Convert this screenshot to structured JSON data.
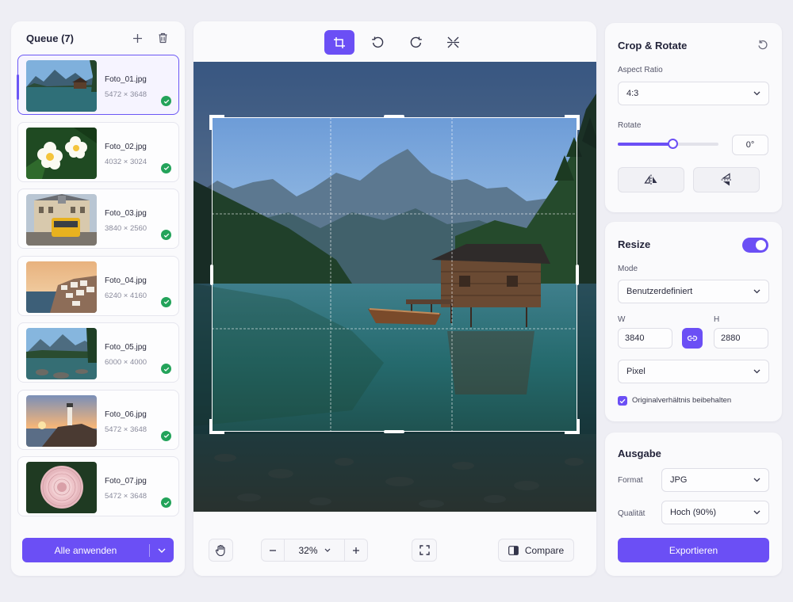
{
  "queue": {
    "title": "Queue (7)",
    "items": [
      {
        "name": "Foto_01.jpg",
        "dims": "5472 × 3648",
        "selected": true
      },
      {
        "name": "Foto_02.jpg",
        "dims": "4032 × 3024"
      },
      {
        "name": "Foto_03.jpg",
        "dims": "3840 × 2560"
      },
      {
        "name": "Foto_04.jpg",
        "dims": "6240 × 4160"
      },
      {
        "name": "Foto_05.jpg",
        "dims": "6000 × 4000"
      },
      {
        "name": "Foto_06.jpg",
        "dims": "5472 × 3648"
      },
      {
        "name": "Foto_07.jpg",
        "dims": "5472 × 3648"
      }
    ],
    "apply_label": "Alle anwenden"
  },
  "toolbar": {
    "tools": [
      "crop-icon",
      "rotate-left-icon",
      "rotate-right-icon",
      "flip-icon"
    ],
    "active_tool": "crop-icon"
  },
  "bottom": {
    "zoom": "32%",
    "compare_label": "Compare"
  },
  "crop": {
    "title": "Crop & Rotate",
    "aspect_label": "Aspect Ratio",
    "aspect_value": "4:3",
    "rotate_label": "Rotate",
    "rotate_value": "0°",
    "rotate_slider_fraction": 0.54
  },
  "resize": {
    "title": "Resize",
    "enabled": true,
    "mode_label": "Mode",
    "mode_value": "Benutzerdefiniert",
    "w_label": "W",
    "h_label": "H",
    "w_value": "3840",
    "h_value": "2880",
    "unit_value": "Pixel",
    "keep_ratio_label": "Originalverhältnis beibehalten",
    "keep_ratio_checked": true
  },
  "output": {
    "title": "Ausgabe",
    "format_label": "Format",
    "format_value": "JPG",
    "quality_label": "Qualität",
    "quality_value": "Hoch (90%)",
    "export_label": "Exportieren"
  },
  "colors": {
    "accent": "#6b4ff5",
    "success": "#23a35a"
  }
}
